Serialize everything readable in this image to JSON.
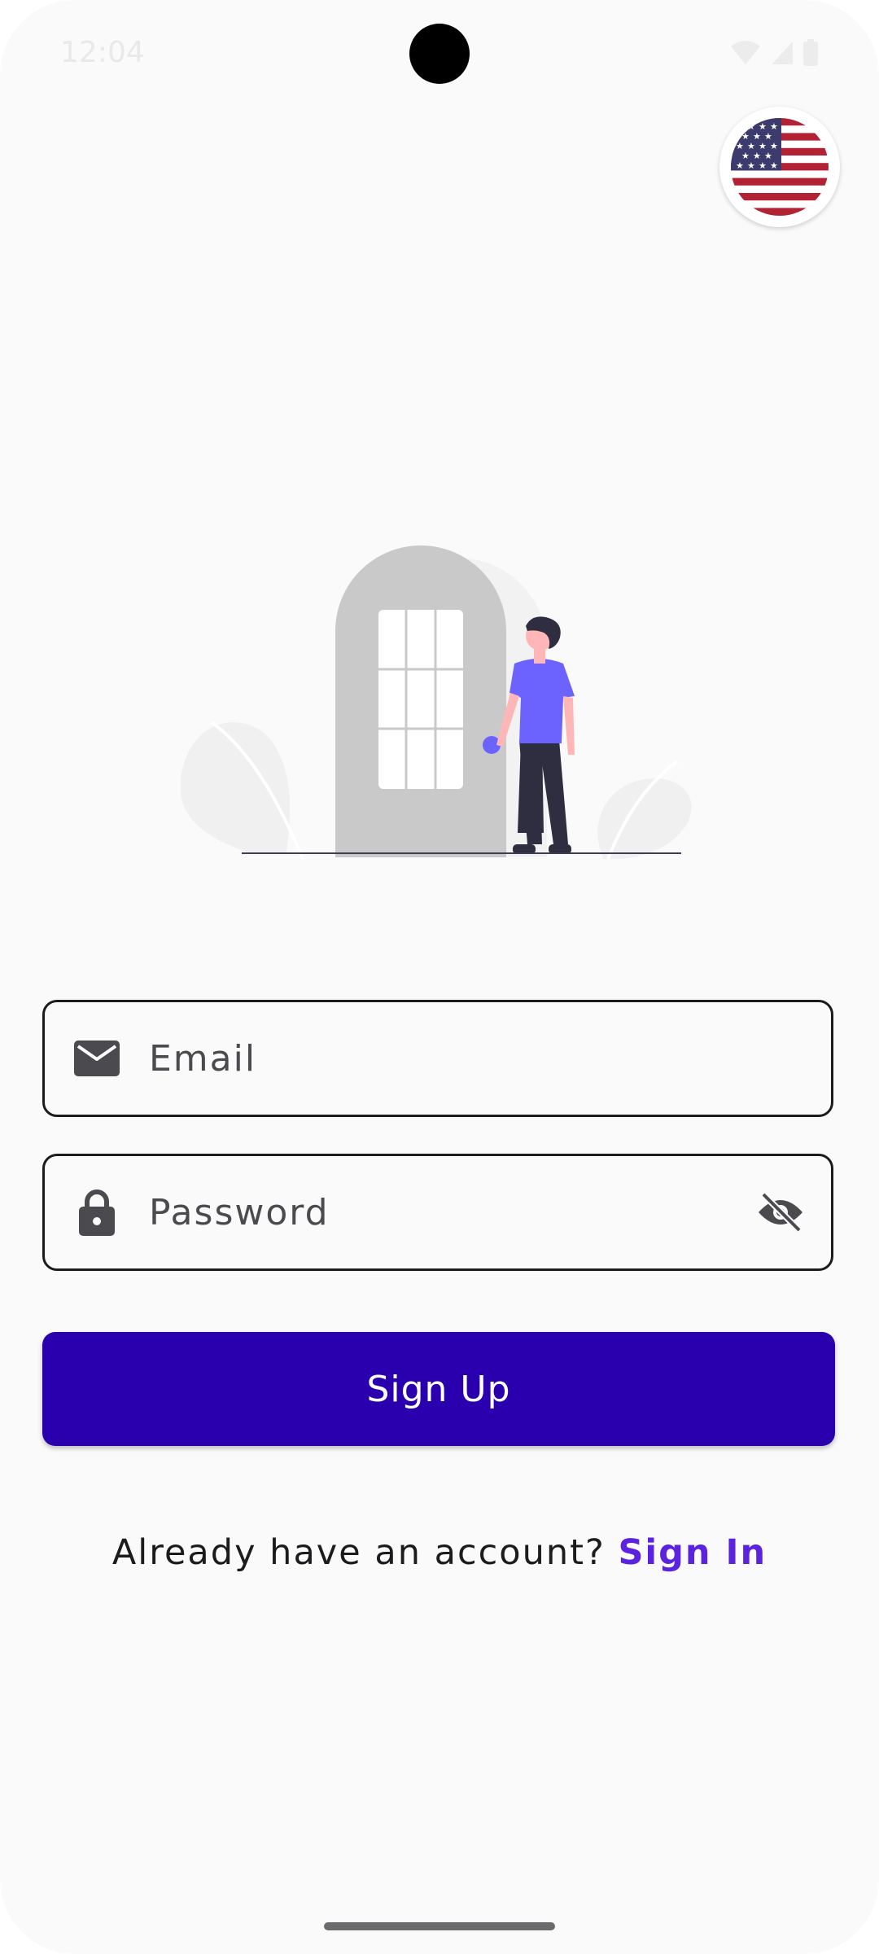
{
  "status_bar": {
    "time": "12:04"
  },
  "language": {
    "icon": "us-flag-icon"
  },
  "form": {
    "email_placeholder": "Email",
    "password_placeholder": "Password",
    "submit_label": "Sign Up"
  },
  "footer": {
    "prompt": "Already have an account? ",
    "link": "Sign In"
  },
  "colors": {
    "primary": "#2a00ae",
    "link": "#5b22e0",
    "background": "#fafafa",
    "accent_figure": "#6c63ff"
  }
}
